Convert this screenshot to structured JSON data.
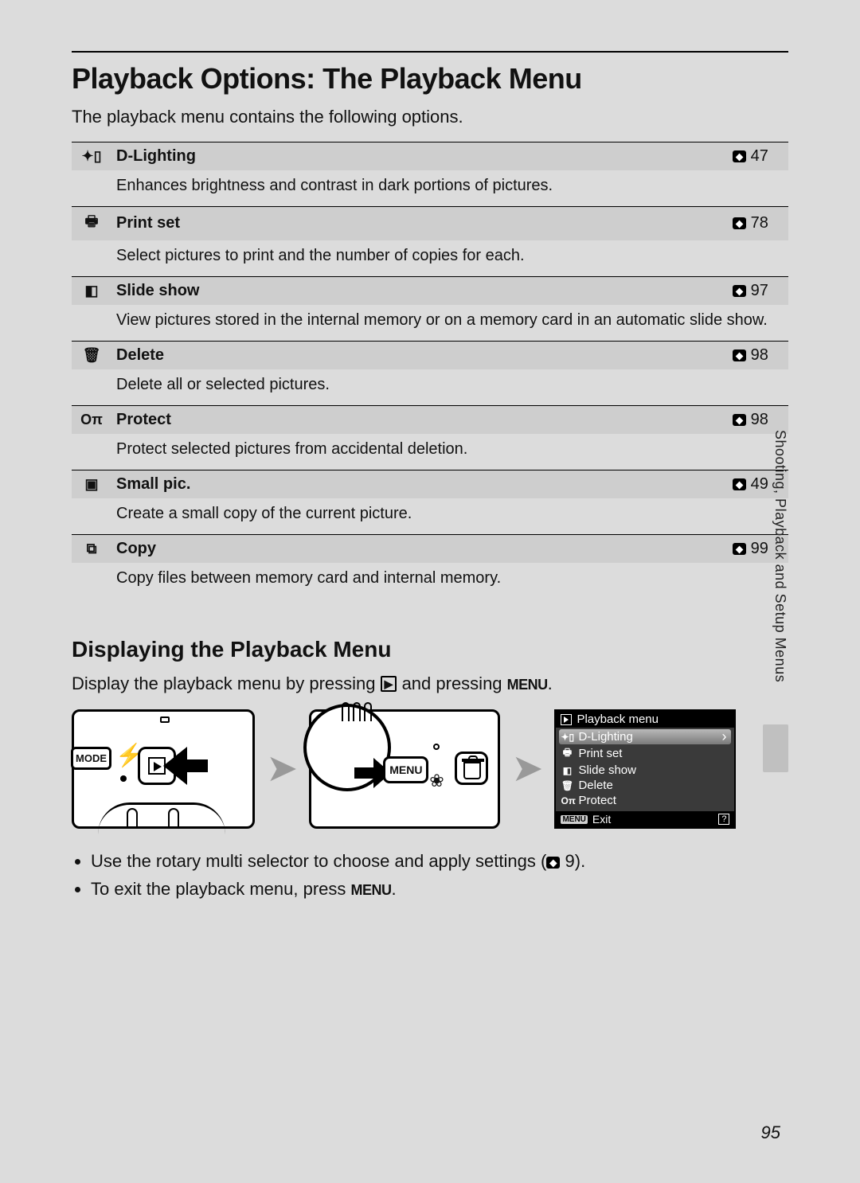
{
  "page_number": "95",
  "side_tab": "Shooting, Playback and Setup Menus",
  "h1": "Playback Options: The Playback Menu",
  "intro": "The playback menu contains the following options.",
  "options": [
    {
      "icon": "✦▯",
      "title": "D-Lighting",
      "page": "47",
      "desc": "Enhances brightness and contrast in dark portions of pictures."
    },
    {
      "icon": "🖶",
      "title": "Print set",
      "page": "78",
      "desc": "Select pictures to print and the number of copies for each."
    },
    {
      "icon": "◧",
      "title": "Slide show",
      "page": "97",
      "desc": "View pictures stored in the internal memory or on a memory card in an automatic slide show."
    },
    {
      "icon": "🗑",
      "title": "Delete",
      "page": "98",
      "desc": "Delete all or selected pictures."
    },
    {
      "icon": "Oπ",
      "title": "Protect",
      "page": "98",
      "desc": "Protect selected pictures from accidental deletion."
    },
    {
      "icon": "▣",
      "title": "Small pic.",
      "page": "49",
      "desc": "Create a small copy of the current picture."
    },
    {
      "icon": "⧉",
      "title": "Copy",
      "page": "99",
      "desc": "Copy files between memory card and internal memory."
    }
  ],
  "h2": "Displaying the Playback Menu",
  "display_instruction": {
    "pre": "Display the playback menu by pressing ",
    "mid": " and pressing ",
    "post": ".",
    "play_glyph": "▶",
    "menu_glyph": "MENU"
  },
  "mini_screen": {
    "title": "Playback menu",
    "items": [
      {
        "icon": "✦▯",
        "label": "D-Lighting",
        "selected": true
      },
      {
        "icon": "🖶",
        "label": "Print set",
        "selected": false
      },
      {
        "icon": "◧",
        "label": "Slide show",
        "selected": false
      },
      {
        "icon": "🗑",
        "label": "Delete",
        "selected": false
      },
      {
        "icon": "Oπ",
        "label": "Protect",
        "selected": false
      }
    ],
    "footer_menu": "MENU",
    "footer_exit": "Exit",
    "footer_help": "?"
  },
  "diagram_a": {
    "mode": "MODE"
  },
  "diagram_b": {
    "menu": "MENU"
  },
  "bullets": {
    "b1_pre": "Use the rotary multi selector to choose and apply settings (",
    "b1_page": "9",
    "b1_post": ").",
    "b2_pre": "To exit the playback menu, press ",
    "b2_menu": "MENU",
    "b2_post": "."
  }
}
